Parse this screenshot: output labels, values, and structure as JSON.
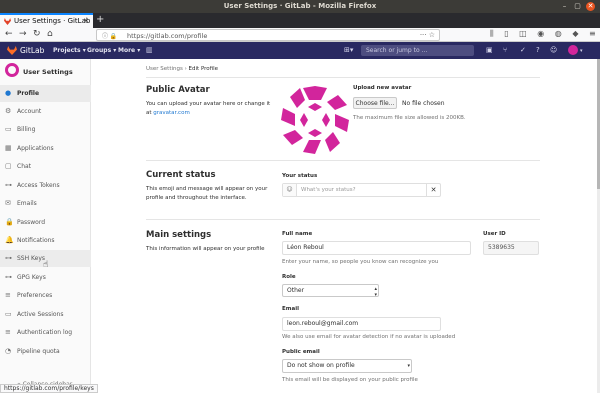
{
  "window": {
    "title": "User Settings · GitLab - Mozilla Firefox",
    "controls": [
      "–",
      "▢",
      "✕"
    ]
  },
  "browser": {
    "tab_label": "User Settings · GitLab",
    "tab_close": "✕",
    "new_tab": "+",
    "url": "https://gitlab.com/profile",
    "status_url": "https://gitlab.com/profile/keys"
  },
  "gitlab_nav": {
    "brand": "GitLab",
    "menus": [
      "Projects ▾",
      "Groups ▾",
      "More ▾"
    ],
    "search_placeholder": "Search or jump to ..."
  },
  "sidebar": {
    "title": "User Settings",
    "items": [
      {
        "label": "Profile",
        "icon": "●"
      },
      {
        "label": "Account",
        "icon": "⚙"
      },
      {
        "label": "Billing",
        "icon": "▭"
      },
      {
        "label": "Applications",
        "icon": "▦"
      },
      {
        "label": "Chat",
        "icon": "▢"
      },
      {
        "label": "Access Tokens",
        "icon": "⊶"
      },
      {
        "label": "Emails",
        "icon": "✉"
      },
      {
        "label": "Password",
        "icon": "🔒"
      },
      {
        "label": "Notifications",
        "icon": "🔔"
      },
      {
        "label": "SSH Keys",
        "icon": "⊶"
      },
      {
        "label": "GPG Keys",
        "icon": "⊶"
      },
      {
        "label": "Preferences",
        "icon": "≡"
      },
      {
        "label": "Active Sessions",
        "icon": "▭"
      },
      {
        "label": "Authentication log",
        "icon": "≡"
      },
      {
        "label": "Pipeline quota",
        "icon": "◔"
      }
    ],
    "collapse_label": "« Collapse sidebar"
  },
  "breadcrumb": {
    "parent": "User Settings",
    "separator": "›",
    "current": "Edit Profile"
  },
  "avatar_section": {
    "title": "Public Avatar",
    "description": "You can upload your avatar here or change it at",
    "link": "gravatar.com",
    "upload_label": "Upload new avatar",
    "choose_button": "Choose file...",
    "no_file": "No file chosen",
    "max_size_hint": "The maximum file size allowed is 200KB.",
    "avatar_color": "#d2259c"
  },
  "status_section": {
    "title": "Current status",
    "description": "This emoji and message will appear on your profile and throughout the interface.",
    "field_label": "Your status",
    "placeholder": "What's your status?",
    "clear": "✕"
  },
  "main_section": {
    "title": "Main settings",
    "description": "This information will appear on your profile",
    "full_name_label": "Full name",
    "full_name_value": "Léon  Reboul",
    "full_name_hint": "Enter your name, so people you know can recognize you",
    "user_id_label": "User ID",
    "user_id_value": "5389635",
    "role_label": "Role",
    "role_value": "Other",
    "email_label": "Email",
    "email_value": "leon.reboul@gmail.com",
    "email_hint": "We also use email for avatar detection if no avatar is uploaded",
    "public_email_label": "Public email",
    "public_email_value": "Do not show on profile",
    "public_email_hint": "This email will be displayed on your public profile"
  }
}
